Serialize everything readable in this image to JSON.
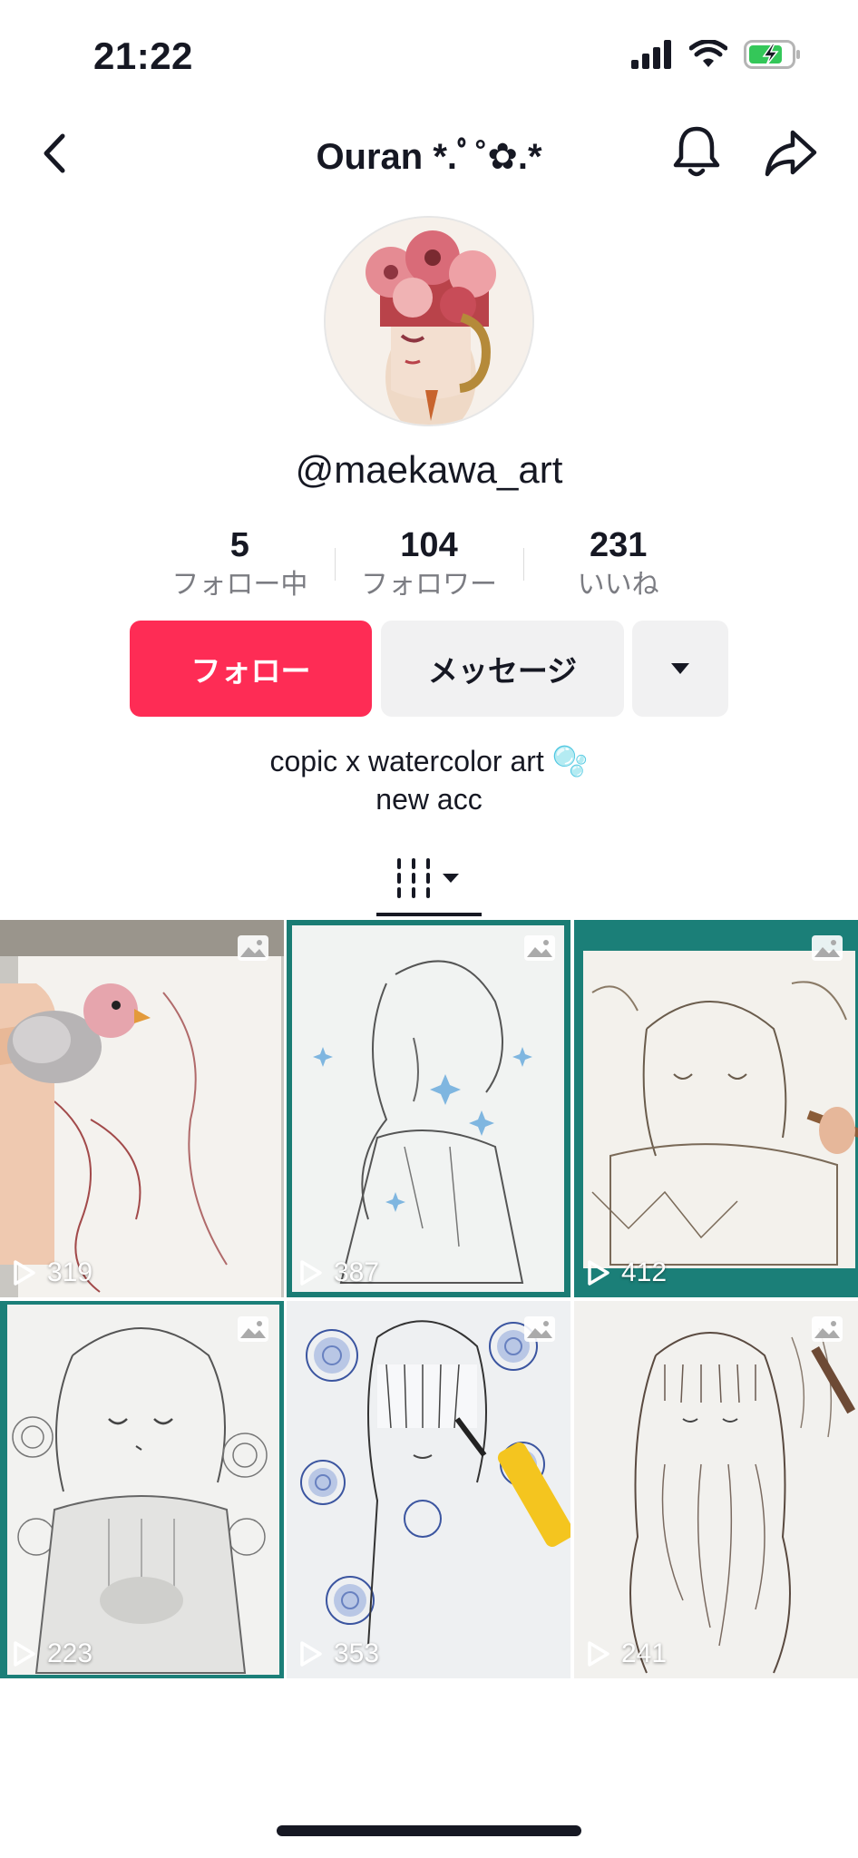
{
  "status_bar": {
    "time": "21:22"
  },
  "nav": {
    "title": "Ouran *.ﾟ˚✿.*"
  },
  "profile": {
    "username": "@maekawa_art",
    "stats": [
      {
        "value": "5",
        "label": "フォロー中"
      },
      {
        "value": "104",
        "label": "フォロワー"
      },
      {
        "value": "231",
        "label": "いいね"
      }
    ],
    "bio_line1": "copic x watercolor  art 🫧",
    "bio_line2": "new acc"
  },
  "buttons": {
    "follow": "フォロー",
    "message": "メッセージ"
  },
  "icons": [
    "back-icon",
    "bell-icon",
    "share-icon",
    "dropdown-arrow-icon",
    "grid-filter-icon",
    "photo-icon",
    "play-icon"
  ],
  "colors": {
    "accent": "#fe2c55",
    "secondary_bg": "#f1f1f2",
    "text": "#161823"
  },
  "videos": [
    {
      "views": "319"
    },
    {
      "views": "387"
    },
    {
      "views": "412"
    },
    {
      "views": "223"
    },
    {
      "views": "353"
    },
    {
      "views": "241"
    }
  ]
}
